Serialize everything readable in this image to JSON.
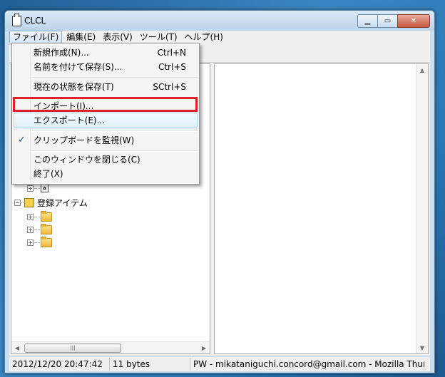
{
  "window": {
    "title": "CLCL"
  },
  "menubar": [
    {
      "label": "ファイル(F)",
      "active": true
    },
    {
      "label": "編集(E)"
    },
    {
      "label": "表示(V)"
    },
    {
      "label": "ツール(T)"
    },
    {
      "label": "ヘルプ(H)"
    }
  ],
  "file_menu": {
    "new": {
      "label": "新規作成(N)...",
      "shortcut": "Ctrl+N"
    },
    "save_as": {
      "label": "名前を付けて保存(S)...",
      "shortcut": "Ctrl+S"
    },
    "save_state": {
      "label": "現在の状態を保存(T)",
      "shortcut": "SCtrl+S"
    },
    "import": {
      "label": "インポート(I)..."
    },
    "export": {
      "label": "エクスポート(E)..."
    },
    "monitor": {
      "label": "クリップボードを監視(W)",
      "checked": true
    },
    "close_window": {
      "label": "このウィンドウを閉じる(C)"
    },
    "exit": {
      "label": "終了(X)"
    }
  },
  "tree": {
    "history_item_icon": "a",
    "registered_label": "登録アイテム"
  },
  "statusbar": {
    "datetime": "2012/12/20 20:47:42",
    "size": "11 bytes",
    "window_title": "PW - mikataniguchi.concord@gmail.com - Mozilla Thunderbird"
  },
  "icons": {
    "minimize": "minimize-icon",
    "maximize": "maximize-icon",
    "close": "close-icon"
  },
  "colors": {
    "highlight_box": "#e0202a"
  }
}
